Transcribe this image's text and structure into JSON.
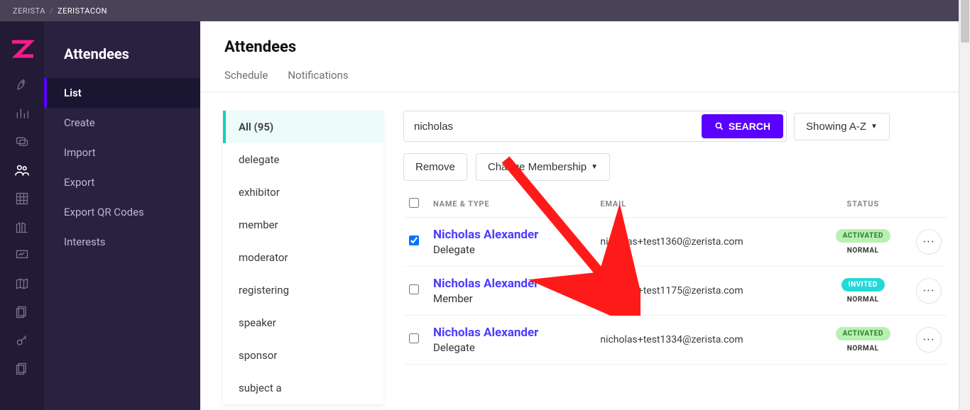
{
  "breadcrumb": {
    "root": "ZERISTA",
    "current": "ZERISTACON"
  },
  "sidepanel": {
    "title": "Attendees",
    "items": [
      {
        "label": "List",
        "active": true
      },
      {
        "label": "Create"
      },
      {
        "label": "Import"
      },
      {
        "label": "Export"
      },
      {
        "label": "Export QR Codes"
      },
      {
        "label": "Interests"
      }
    ]
  },
  "page": {
    "title": "Attendees",
    "subtabs": [
      {
        "label": "Schedule"
      },
      {
        "label": "Notifications"
      }
    ]
  },
  "filters": {
    "items": [
      {
        "label": "All (95)",
        "active": true
      },
      {
        "label": "delegate"
      },
      {
        "label": "exhibitor"
      },
      {
        "label": "member"
      },
      {
        "label": "moderator"
      },
      {
        "label": "registering"
      },
      {
        "label": "speaker"
      },
      {
        "label": "sponsor"
      },
      {
        "label": "subject a"
      }
    ]
  },
  "toolbar": {
    "search_value": "nicholas",
    "search_label": "SEARCH",
    "sort_label": "Showing A-Z",
    "remove_label": "Remove",
    "change_membership_label": "Change Membership"
  },
  "table": {
    "columns": {
      "name": "NAME & TYPE",
      "email": "EMAIL",
      "status": "STATUS"
    },
    "rows": [
      {
        "checked": true,
        "name": "Nicholas Alexander",
        "role": "Delegate",
        "email": "nicholas+test1360@zerista.com",
        "badge": "ACTIVATED",
        "badge_class": "badge-activated",
        "sub": "NORMAL"
      },
      {
        "checked": false,
        "name": "Nicholas Alexander",
        "role": "Member",
        "email": "nicholas+test1175@zerista.com",
        "badge": "INVITED",
        "badge_class": "badge-invited",
        "sub": "NORMAL"
      },
      {
        "checked": false,
        "name": "Nicholas Alexander",
        "role": "Delegate",
        "email": "nicholas+test1334@zerista.com",
        "badge": "ACTIVATED",
        "badge_class": "badge-activated",
        "sub": "NORMAL"
      }
    ]
  },
  "colors": {
    "accent": "#5a00ff",
    "teal": "#14d1b8"
  }
}
